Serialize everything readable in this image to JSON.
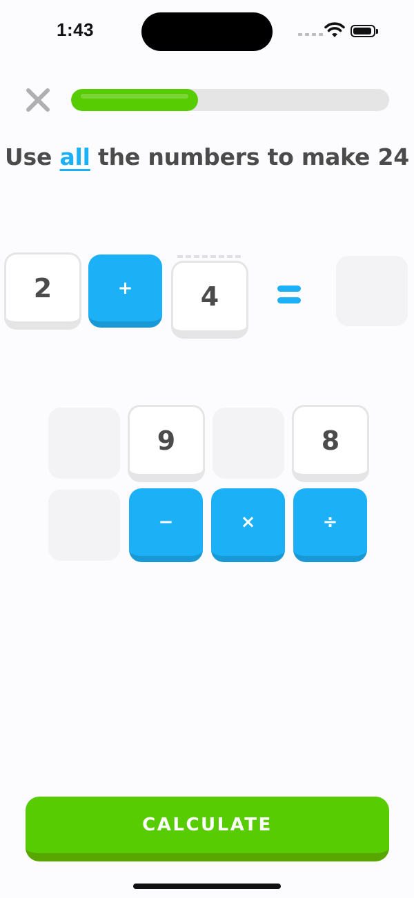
{
  "status_bar": {
    "time": "1:43"
  },
  "header": {
    "close_icon": "x-icon",
    "progress": 0.4
  },
  "prompt": {
    "before": "Use ",
    "highlight": "all",
    "after": " the numbers to make 24"
  },
  "equation": {
    "left_number": "2",
    "operator": "+",
    "right_number": "4",
    "equals_icon": "equals-icon",
    "result": ""
  },
  "tiles": {
    "row1": [
      "",
      "9",
      "",
      "8"
    ],
    "row2_operators": [
      "−",
      "×",
      "÷"
    ]
  },
  "calculate_button": "CALCULATE",
  "colors": {
    "accent_blue": "#1cb0f6",
    "green": "#58cc02",
    "track": "#e5e5e5"
  }
}
